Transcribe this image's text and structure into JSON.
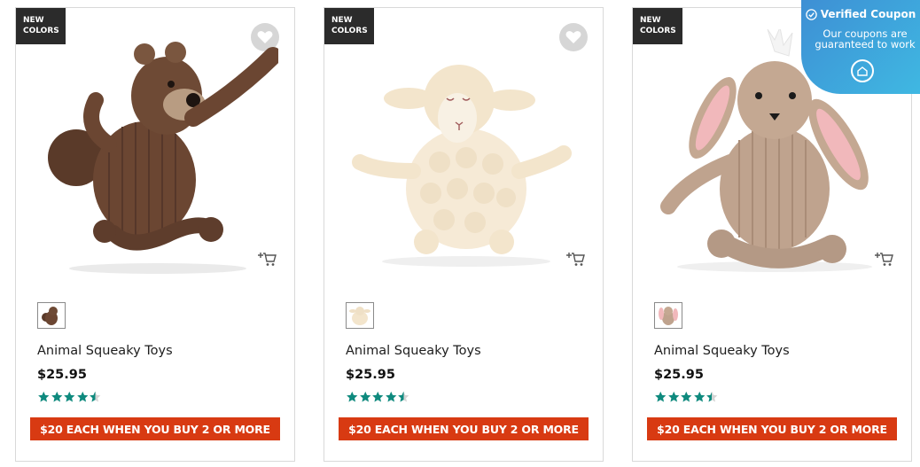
{
  "products": [
    {
      "badge_line1": "NEW",
      "badge_line2": "COLORS",
      "name": "Animal Squeaky Toys",
      "price": "$25.95",
      "rating": 4.5,
      "rating_max": 5,
      "promo": "$20 EACH WHEN YOU BUY 2 OR MORE",
      "image": "squirrel-plush-icon",
      "swatch": "squirrel-swatch-icon",
      "has_favorite": true
    },
    {
      "badge_line1": "NEW",
      "badge_line2": "COLORS",
      "name": "Animal Squeaky Toys",
      "price": "$25.95",
      "rating": 4.5,
      "rating_max": 5,
      "promo": "$20 EACH WHEN YOU BUY 2 OR MORE",
      "image": "lamb-plush-icon",
      "swatch": "lamb-swatch-icon",
      "has_favorite": true
    },
    {
      "badge_line1": "NEW",
      "badge_line2": "COLORS",
      "name": "Animal Squeaky Toys",
      "price": "$25.95",
      "rating": 4.5,
      "rating_max": 5,
      "promo": "$20 EACH WHEN YOU BUY 2 OR MORE",
      "image": "bunny-plush-icon",
      "swatch": "bunny-swatch-icon",
      "has_favorite": false
    }
  ],
  "coupon": {
    "title": "Verified Coupon",
    "line1": "Our coupons are",
    "line2": "guaranteed to work",
    "icon": "house-icon"
  },
  "colors": {
    "promo": "#d83a12",
    "star": "#0f8a7e",
    "badge": "#2b2b2b",
    "coupon_start": "#3e8fd4",
    "coupon_end": "#3fb8e2"
  }
}
